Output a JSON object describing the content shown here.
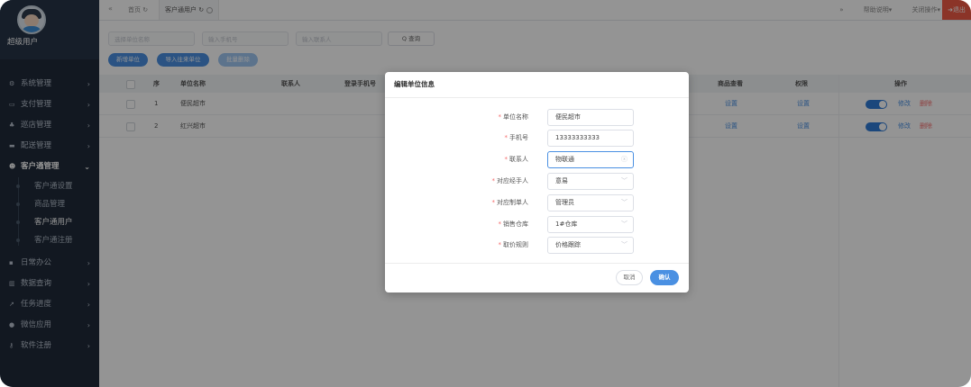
{
  "sidebar": {
    "username": "超级用户",
    "items": [
      {
        "label": "系统管理",
        "icon": "gears-icon",
        "glyph": "⚙"
      },
      {
        "label": "支付管理",
        "icon": "card-icon",
        "glyph": "▭"
      },
      {
        "label": "巡店管理",
        "icon": "sitemap-icon",
        "glyph": "♣"
      },
      {
        "label": "配送管理",
        "icon": "truck-icon",
        "glyph": "▬"
      },
      {
        "label": "客户通管理",
        "icon": "users-icon",
        "glyph": "☻"
      },
      {
        "label": "日常办公",
        "icon": "briefcase-icon",
        "glyph": "▪"
      },
      {
        "label": "数据查询",
        "icon": "bar-chart-icon",
        "glyph": "▥"
      },
      {
        "label": "任务进度",
        "icon": "line-chart-icon",
        "glyph": "↗"
      },
      {
        "label": "微信应用",
        "icon": "wechat-icon",
        "glyph": "●"
      },
      {
        "label": "软件注册",
        "icon": "key-icon",
        "glyph": "⚷"
      }
    ],
    "subitems": [
      "客户通设置",
      "商品管理",
      "客户通用户",
      "客户通注册"
    ]
  },
  "topbar": {
    "back": "«",
    "home_tab": "首页",
    "current_tab": "客户通用户",
    "help": "帮助说明",
    "close_ops": "关闭操作",
    "forward": "»",
    "exit": "退出"
  },
  "filters": {
    "unit_placeholder": "选择单位名称",
    "phone_placeholder": "输入手机号",
    "contact_placeholder": "输入联系人",
    "search_label": "Q 查询"
  },
  "actions": {
    "add": "新增单位",
    "import": "导入往来单位",
    "batch_delete": "批量删除"
  },
  "table": {
    "headers": {
      "seq": "序",
      "name": "单位名称",
      "contact": "联系人",
      "phone": "登录手机号",
      "goods_view": "商品查看",
      "permission": "权限",
      "operation": "操作"
    },
    "rows": [
      {
        "seq": "1",
        "name": "便民超市",
        "goods_view": "设置",
        "permission": "设置",
        "edit": "修改",
        "delete": "删除"
      },
      {
        "seq": "2",
        "name": "红兴超市",
        "goods_view": "设置",
        "permission": "设置",
        "edit": "修改",
        "delete": "删除"
      }
    ]
  },
  "dialog": {
    "title": "编辑单位信息",
    "fields": [
      {
        "label": "单位名称",
        "value": "便民超市",
        "suffix": ""
      },
      {
        "label": "手机号",
        "value": "13333333333",
        "suffix": ""
      },
      {
        "label": "联系人",
        "value": "物联通",
        "suffix": "ⓧ"
      },
      {
        "label": "对应经手人",
        "value": "意易",
        "suffix": "﹀"
      },
      {
        "label": "对应制单人",
        "value": "管理员",
        "suffix": "﹀"
      },
      {
        "label": "销售仓库",
        "value": "1#仓库",
        "suffix": "﹀"
      },
      {
        "label": "取价规则",
        "value": "价格跟踪",
        "suffix": "﹀"
      }
    ],
    "cancel": "取消",
    "confirm": "确认"
  },
  "colors": {
    "accent": "#4a90e2",
    "sidebar": "#1f2a3a",
    "danger": "#ef5a46"
  }
}
